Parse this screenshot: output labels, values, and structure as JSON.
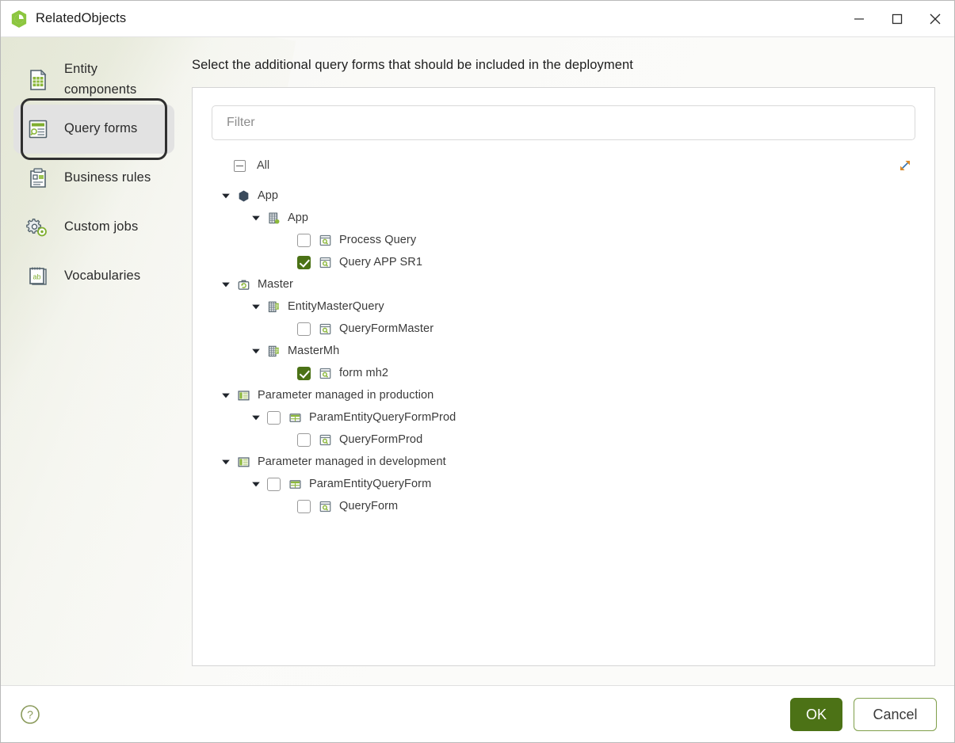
{
  "window": {
    "title": "RelatedObjects",
    "icon": "app-hexagon-clock-icon",
    "controls": {
      "minimize": "minimize-icon",
      "maximize": "maximize-icon",
      "close": "close-icon"
    }
  },
  "sidebar": {
    "items": [
      {
        "label": "Entity components",
        "icon": "entity-components-icon",
        "selected": false
      },
      {
        "label": "Query forms",
        "icon": "query-forms-icon",
        "selected": true
      },
      {
        "label": "Business rules",
        "icon": "business-rules-icon",
        "selected": false
      },
      {
        "label": "Custom jobs",
        "icon": "custom-jobs-icon",
        "selected": false
      },
      {
        "label": "Vocabularies",
        "icon": "vocabularies-icon",
        "selected": false
      }
    ]
  },
  "main": {
    "heading": "Select the additional query forms that should be included in the deployment",
    "filter": {
      "value": "",
      "placeholder": "Filter"
    },
    "tree_header": {
      "all_label": "All",
      "all_state": "indeterminate",
      "collapse_all_icon": "collapse-all-icon"
    },
    "tree": [
      {
        "label": "App",
        "indent": 0,
        "twisty": "expanded",
        "checkbox": "none",
        "icon": "app-node-icon"
      },
      {
        "label": "App",
        "indent": 1,
        "twisty": "expanded",
        "checkbox": "none",
        "icon": "entity-grid-icon"
      },
      {
        "label": "Process Query",
        "indent": 2,
        "twisty": "none",
        "checkbox": "unchecked",
        "icon": "query-form-icon"
      },
      {
        "label": "Query APP SR1",
        "indent": 2,
        "twisty": "none",
        "checkbox": "checked",
        "icon": "query-form-icon"
      },
      {
        "label": "Master",
        "indent": 0,
        "twisty": "expanded",
        "checkbox": "none",
        "icon": "briefcase-icon"
      },
      {
        "label": "EntityMasterQuery",
        "indent": 1,
        "twisty": "expanded",
        "checkbox": "none",
        "icon": "entity-master-icon"
      },
      {
        "label": "QueryFormMaster",
        "indent": 2,
        "twisty": "none",
        "checkbox": "unchecked",
        "icon": "query-form-icon"
      },
      {
        "label": "MasterMh",
        "indent": 1,
        "twisty": "expanded",
        "checkbox": "none",
        "icon": "entity-master-icon"
      },
      {
        "label": "form mh2",
        "indent": 2,
        "twisty": "none",
        "checkbox": "checked",
        "icon": "query-form-icon"
      },
      {
        "label": "Parameter managed in production",
        "indent": 0,
        "twisty": "expanded",
        "checkbox": "none",
        "icon": "parameter-icon"
      },
      {
        "label": "ParamEntityQueryFormProd",
        "indent": 1,
        "twisty": "expanded",
        "checkbox": "unchecked",
        "icon": "param-entity-icon"
      },
      {
        "label": "QueryFormProd",
        "indent": 2,
        "twisty": "none",
        "checkbox": "unchecked",
        "icon": "query-form-icon"
      },
      {
        "label": "Parameter managed in development",
        "indent": 0,
        "twisty": "expanded",
        "checkbox": "none",
        "icon": "parameter-icon"
      },
      {
        "label": "ParamEntityQueryForm",
        "indent": 1,
        "twisty": "expanded",
        "checkbox": "unchecked",
        "icon": "param-entity-icon"
      },
      {
        "label": "QueryForm",
        "indent": 2,
        "twisty": "none",
        "checkbox": "unchecked",
        "icon": "query-form-icon"
      }
    ]
  },
  "footer": {
    "help_icon": "help-circle-icon",
    "ok_label": "OK",
    "cancel_label": "Cancel"
  },
  "colors": {
    "accent_green": "#4c7216",
    "light_green": "#8cb83c",
    "cancel_border": "#7f9f4a",
    "selected_nav": "#e2e2e2",
    "focus_ring": "#2f2f2f"
  }
}
